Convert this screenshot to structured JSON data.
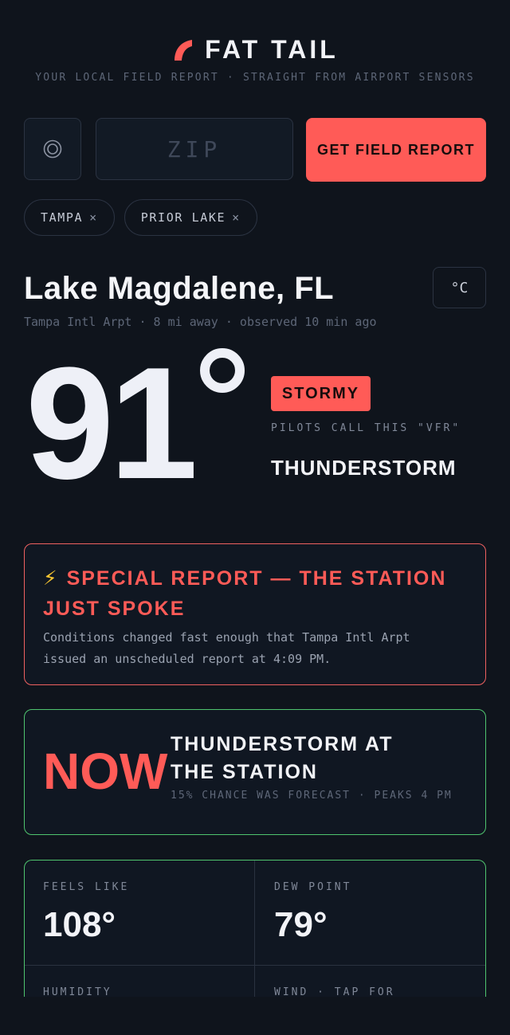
{
  "header": {
    "brand": "FAT TAIL",
    "tagline": "YOUR LOCAL FIELD REPORT · STRAIGHT FROM AIRPORT SENSORS",
    "accent": "#ff5b57"
  },
  "search": {
    "location_icon": "target-icon",
    "zip_placeholder": "ZIP",
    "zip_value": "",
    "button_label": "GET FIELD REPORT"
  },
  "recent": [
    {
      "label": "TAMPA",
      "remove": "×"
    },
    {
      "label": "PRIOR LAKE",
      "remove": "×"
    }
  ],
  "location": {
    "name": "Lake Magdalene, FL",
    "meta": "Tampa Intl Arpt · 8 mi away · observed 10 min ago",
    "unit_toggle": "°C"
  },
  "current": {
    "temp": "91",
    "badge": "STORMY",
    "pilot_note": "PILOTS CALL THIS \"VFR\"",
    "condition": "THUNDERSTORM"
  },
  "special_report": {
    "icon": "⚡",
    "title": "SPECIAL REPORT — THE STATION JUST SPOKE",
    "body": "Conditions changed fast enough that Tampa Intl Arpt issued an unscheduled report at 4:09 PM.",
    "border_color": "#ef6160"
  },
  "now": {
    "word": "NOW",
    "title": "THUNDERSTORM AT THE STATION",
    "subtitle": "15% CHANCE WAS FORECAST · PEAKS 4 PM",
    "border_color": "#4fc46e"
  },
  "metrics": [
    {
      "label": "FEELS LIKE",
      "value": "108°"
    },
    {
      "label": "DEW POINT",
      "value": "79°"
    },
    {
      "label": "HUMIDITY",
      "value": ""
    },
    {
      "label": "WIND · TAP FOR",
      "value": ""
    }
  ]
}
